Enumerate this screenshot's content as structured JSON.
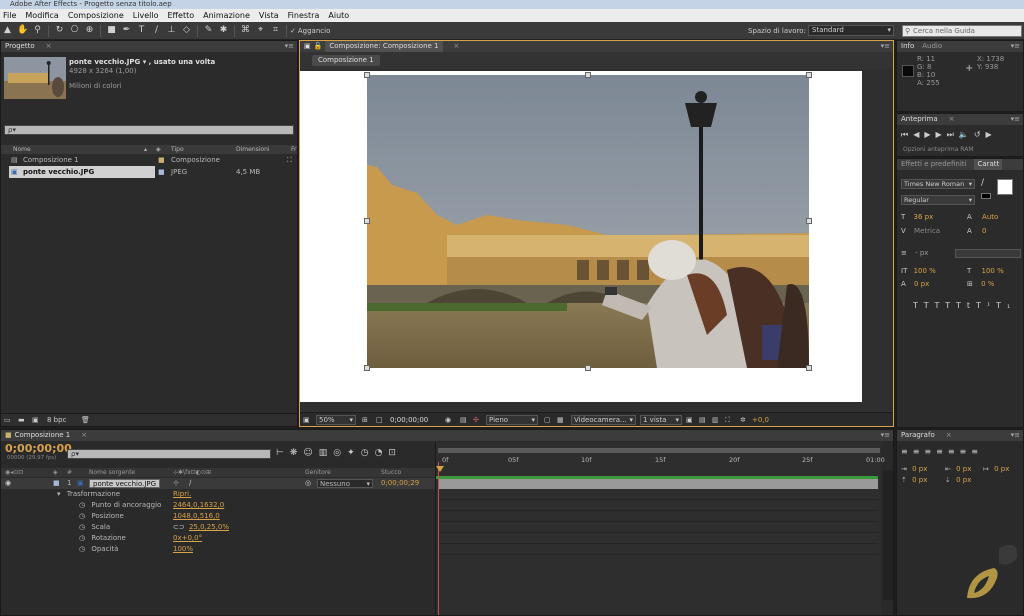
{
  "window": {
    "title": "Adobe After Effects - Progetto senza titolo.aep"
  },
  "menu": [
    "File",
    "Modifica",
    "Composizione",
    "Livello",
    "Effetto",
    "Animazione",
    "Vista",
    "Finestra",
    "Aiuto"
  ],
  "toolbar": {
    "snap_label": "Aggancio",
    "workspace_label": "Spazio di lavoro:",
    "workspace_value": "Standard",
    "search_placeholder": "Cerca nella Guida"
  },
  "project": {
    "tab": "Progetto",
    "preview_name": "ponte vecchio.JPG ▾ , usato una volta",
    "preview_size": "4928 x 3264 (1,00)",
    "preview_colors": "Milioni di colori",
    "search_value": "ρ▾",
    "columns": {
      "name": "Nome",
      "type": "Tipo",
      "size": "Dimensioni",
      "fr": "Fr"
    },
    "items": [
      {
        "name": "Composizione 1",
        "type": "Composizione",
        "size": ""
      },
      {
        "name": "ponte vecchio.JPG",
        "type": "JPEG",
        "size": "4,5 MB"
      }
    ],
    "bpc": "8 bpc"
  },
  "composition": {
    "tab": "Composizione: Composizione 1",
    "subtab": "Composizione 1",
    "zoom": "50%",
    "timecode": "0;00;00;00",
    "resolution": "Pieno",
    "camera": "Videocamera...",
    "views": "1 vista",
    "exposure": "+0,0"
  },
  "info": {
    "tab_info": "Info",
    "tab_audio": "Audio",
    "r": "R: 11",
    "g": "G: 8",
    "b": "B: 10",
    "a": "A: 255",
    "x": "X: 1738",
    "y": "Y: 938"
  },
  "preview": {
    "tab": "Anteprima",
    "ram": "Opzioni anteprima RAM"
  },
  "character": {
    "tab_effects": "Effetti e predefiniti",
    "tab_char": "Caratt",
    "font": "Times New Roman",
    "style": "Regular",
    "size": "36 px",
    "leading": "Auto",
    "kerning": "Metrica",
    "tracking": "0",
    "stroke": "- px",
    "vscale": "100 %",
    "hscale": "100 %",
    "baseline": "0 px",
    "tsume": "0 %"
  },
  "timeline": {
    "tab": "Composizione 1",
    "timecode": "0;00;00;00",
    "fps": "00000 (29,97 fps)",
    "search_value": "ρ▾",
    "col_source": "Nome sorgente",
    "col_parent": "Genitore",
    "col_stretch": "Stucco",
    "layer_num": "1",
    "layer_name": "ponte vecchio.JPG",
    "parent_value": "Nessuno",
    "layer_time": "0;00;00;29",
    "transform_label": "Trasformazione",
    "transform_reset": "Ripri.",
    "props": [
      {
        "name": "Punto di ancoraggio",
        "value": "2464,0,1632,0"
      },
      {
        "name": "Posizione",
        "value": "1048,0,516,0"
      },
      {
        "name": "Scala",
        "value": "25,0,25,0%"
      },
      {
        "name": "Rotazione",
        "value": "0x+0,0°"
      },
      {
        "name": "Opacità",
        "value": "100%"
      }
    ],
    "ruler": [
      "0f",
      "05f",
      "10f",
      "15f",
      "20f",
      "25f",
      "01:00"
    ]
  },
  "paragraph": {
    "tab": "Paragrafo",
    "indent_left": "0 px",
    "indent_right": "0 px",
    "indent_first": "0 px",
    "space_before": "0 px",
    "space_after": "0 px"
  },
  "colors": {
    "accent": "#d8a248",
    "timeline_green": "#3a9a3a",
    "photo_sky": "#8c95a0",
    "panel": "#2b2b2b"
  }
}
